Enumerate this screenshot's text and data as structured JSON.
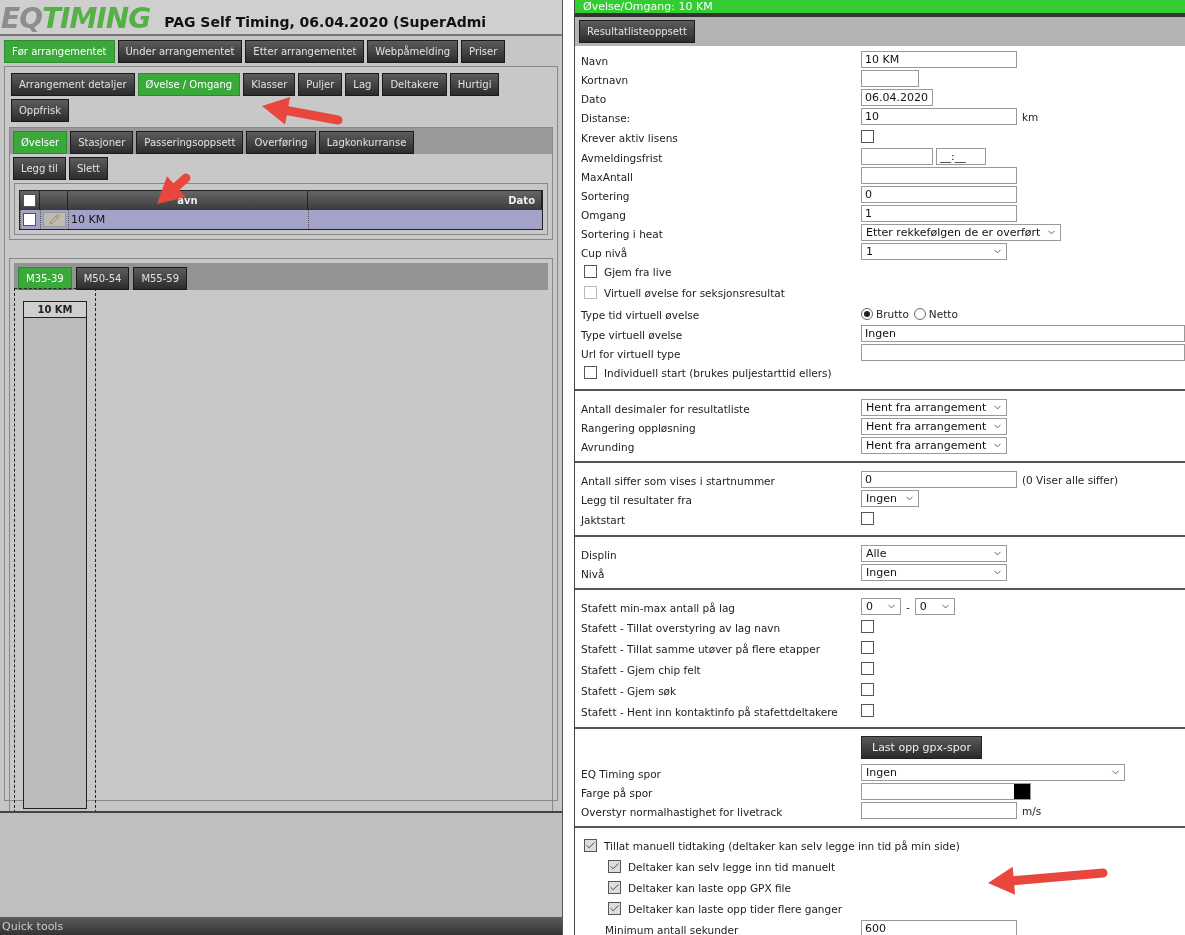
{
  "header": {
    "logo_prefix": "EQ",
    "logo_suffix": "TIMING",
    "title": "PAG Self Timing, 06.04.2020 (SuperAdmi"
  },
  "main_tabs": [
    {
      "label": "Før arrangementet",
      "selected": true
    },
    {
      "label": "Under arrangementet",
      "selected": false
    },
    {
      "label": "Etter arrangementet",
      "selected": false
    },
    {
      "label": "Webpåmelding",
      "selected": false
    },
    {
      "label": "Priser",
      "selected": false
    }
  ],
  "sub_tabs": [
    {
      "label": "Arrangement detaljer",
      "selected": false
    },
    {
      "label": "Øvelse / Omgang",
      "selected": true
    },
    {
      "label": "Klasser",
      "selected": false
    },
    {
      "label": "Puljer",
      "selected": false
    },
    {
      "label": "Lag",
      "selected": false
    },
    {
      "label": "Deltakere",
      "selected": false
    },
    {
      "label": "Hurtigi",
      "selected": false
    }
  ],
  "refresh_button": "Oppfrisk",
  "event_tabs": [
    {
      "label": "Øvelser",
      "selected": true
    },
    {
      "label": "Stasjoner",
      "selected": false
    },
    {
      "label": "Passeringsoppsett",
      "selected": false
    },
    {
      "label": "Overføring",
      "selected": false
    },
    {
      "label": "Lagkonkurranse",
      "selected": false
    }
  ],
  "actions": [
    "Legg til",
    "Slett"
  ],
  "events_table": {
    "all_checked": false,
    "columns": [
      "avn",
      "Dato"
    ],
    "rows": [
      {
        "cells": [
          "10 KM"
        ],
        "selected": true,
        "checked": false
      }
    ]
  },
  "class_tabs": [
    {
      "label": "M35-39",
      "selected": true
    },
    {
      "label": "M50-54",
      "selected": false
    },
    {
      "label": "M55-59",
      "selected": false
    }
  ],
  "board": {
    "columns": [
      {
        "title": "10 KM"
      }
    ]
  },
  "quick_tools": "Quick tools",
  "dialog": {
    "title": "Øvelse/Omgang: 10 KM",
    "tabs": [
      {
        "label": "Resultatlisteoppsett",
        "selected": false
      }
    ],
    "sections": [
      {
        "rows": [
          {
            "kind": "field",
            "label": "Navn",
            "controls": [
              {
                "kind": "input",
                "value": "10 KM"
              }
            ]
          },
          {
            "kind": "field",
            "label": "Kortnavn",
            "controls": [
              {
                "kind": "input"
              }
            ]
          },
          {
            "kind": "field",
            "label": "Dato",
            "controls": [
              {
                "kind": "input",
                "value": "06.04.2020"
              }
            ]
          },
          {
            "kind": "field",
            "label": "Distanse:",
            "controls": [
              {
                "kind": "input",
                "value": "10"
              },
              {
                "kind": "text",
                "value": "km"
              }
            ]
          },
          {
            "kind": "field",
            "label": "Krever aktiv lisens",
            "controls": [
              {
                "kind": "checkbox",
                "checked": false
              }
            ]
          },
          {
            "kind": "field",
            "label": "Avmeldingsfrist",
            "controls": [
              {
                "kind": "input"
              },
              {
                "kind": "input",
                "value": "__:__"
              }
            ]
          },
          {
            "kind": "field",
            "label": "MaxAntall",
            "controls": [
              {
                "kind": "input"
              }
            ]
          },
          {
            "kind": "field",
            "label": "Sortering",
            "controls": [
              {
                "kind": "input",
                "value": "0"
              }
            ]
          },
          {
            "kind": "field",
            "label": "Omgang",
            "controls": [
              {
                "kind": "input",
                "value": "1"
              }
            ]
          },
          {
            "kind": "field",
            "label": "Sortering i heat",
            "controls": [
              {
                "kind": "select",
                "value": "Etter rekkefølgen de er overført"
              }
            ]
          },
          {
            "kind": "field",
            "label": "Cup nivå",
            "controls": [
              {
                "kind": "select",
                "value": "1"
              }
            ]
          },
          {
            "kind": "check",
            "label": "Gjem fra live",
            "checked": false,
            "disabled": false
          },
          {
            "kind": "check",
            "label": "Virtuell øvelse for seksjonsresultat",
            "checked": false,
            "disabled": true
          },
          {
            "kind": "field",
            "label": "Type tid virtuell øvelse",
            "controls": [
              {
                "kind": "radio",
                "label": "Brutto",
                "selected": true
              },
              {
                "kind": "radio",
                "label": "Netto",
                "selected": false
              }
            ]
          },
          {
            "kind": "field",
            "label": "Type virtuell øvelse",
            "controls": [
              {
                "kind": "input",
                "value": "Ingen"
              }
            ]
          },
          {
            "kind": "field",
            "label": "Url for virtuell type",
            "controls": [
              {
                "kind": "input"
              }
            ]
          },
          {
            "kind": "check",
            "label": "Individuell start (brukes puljestarttid ellers)",
            "checked": false,
            "disabled": false
          }
        ]
      },
      {
        "rows": [
          {
            "kind": "field",
            "label": "Antall desimaler for resultatliste",
            "controls": [
              {
                "kind": "select",
                "value": "Hent fra arrangement"
              }
            ]
          },
          {
            "kind": "field",
            "label": "Rangering oppløsning",
            "controls": [
              {
                "kind": "select",
                "value": "Hent fra arrangement"
              }
            ]
          },
          {
            "kind": "field",
            "label": "Avrunding",
            "controls": [
              {
                "kind": "select",
                "value": "Hent fra arrangement"
              }
            ]
          }
        ]
      },
      {
        "rows": [
          {
            "kind": "field",
            "label": "Antall siffer som vises i startnummer",
            "controls": [
              {
                "kind": "input",
                "value": "0"
              },
              {
                "kind": "text",
                "value": "(0 Viser alle siffer)"
              }
            ]
          },
          {
            "kind": "field",
            "label": "Legg til resultater fra",
            "controls": [
              {
                "kind": "select",
                "value": "Ingen"
              }
            ]
          },
          {
            "kind": "field",
            "label": "Jaktstart",
            "controls": [
              {
                "kind": "checkbox",
                "checked": false
              }
            ]
          }
        ]
      },
      {
        "rows": [
          {
            "kind": "field",
            "label": "Displin",
            "controls": [
              {
                "kind": "select",
                "value": "Alle"
              }
            ]
          },
          {
            "kind": "field",
            "label": "Nivå",
            "controls": [
              {
                "kind": "select",
                "value": "Ingen"
              }
            ]
          }
        ]
      },
      {
        "rows": [
          {
            "kind": "field",
            "label": "Stafett min-max antall på lag",
            "controls": [
              {
                "kind": "select",
                "value": "0"
              },
              {
                "kind": "text",
                "value": "-"
              },
              {
                "kind": "select",
                "value": "0"
              }
            ]
          },
          {
            "kind": "field",
            "label": "Stafett - Tillat overstyring av lag navn",
            "controls": [
              {
                "kind": "checkbox",
                "checked": false
              }
            ]
          },
          {
            "kind": "field",
            "label": "Stafett - Tillat samme utøver på flere etapper",
            "controls": [
              {
                "kind": "checkbox",
                "checked": false
              }
            ]
          },
          {
            "kind": "field",
            "label": "Stafett - Gjem chip felt",
            "controls": [
              {
                "kind": "checkbox",
                "checked": false
              }
            ]
          },
          {
            "kind": "field",
            "label": "Stafett - Gjem søk",
            "controls": [
              {
                "kind": "checkbox",
                "checked": false
              }
            ]
          },
          {
            "kind": "field",
            "label": "Stafett - Hent inn kontaktinfo på stafettdeltakere",
            "controls": [
              {
                "kind": "checkbox",
                "checked": false
              }
            ]
          }
        ]
      },
      {
        "rows": [
          {
            "kind": "field",
            "controls": [
              {
                "kind": "button",
                "label": "Last opp gpx-spor"
              }
            ]
          },
          {
            "kind": "field",
            "label": "EQ Timing spor",
            "controls": [
              {
                "kind": "select",
                "value": "Ingen"
              }
            ]
          },
          {
            "kind": "field",
            "label": "Farge på spor",
            "controls": [
              {
                "kind": "color"
              }
            ]
          },
          {
            "kind": "field",
            "label": "Overstyr normalhastighet for livetrack",
            "controls": [
              {
                "kind": "input"
              },
              {
                "kind": "text",
                "value": "m/s"
              }
            ]
          }
        ]
      },
      {
        "rows": [
          {
            "kind": "check",
            "label": "Tillat manuell tidtaking (deltaker kan selv legge inn tid på min side)",
            "checked": true,
            "disabled": false,
            "children": [
              {
                "kind": "check",
                "label": "Deltaker kan selv legge inn tid manuelt",
                "checked": true,
                "disabled": false
              },
              {
                "kind": "check",
                "label": "Deltaker kan laste opp GPX file",
                "checked": true,
                "disabled": false
              },
              {
                "kind": "check",
                "label": "Deltaker kan laste opp tider flere ganger",
                "checked": true,
                "disabled": false
              },
              {
                "kind": "field",
                "label": "Minimum antall sekunder",
                "controls": [
                  {
                    "kind": "input",
                    "value": "600"
                  }
                ]
              }
            ]
          }
        ]
      }
    ]
  }
}
